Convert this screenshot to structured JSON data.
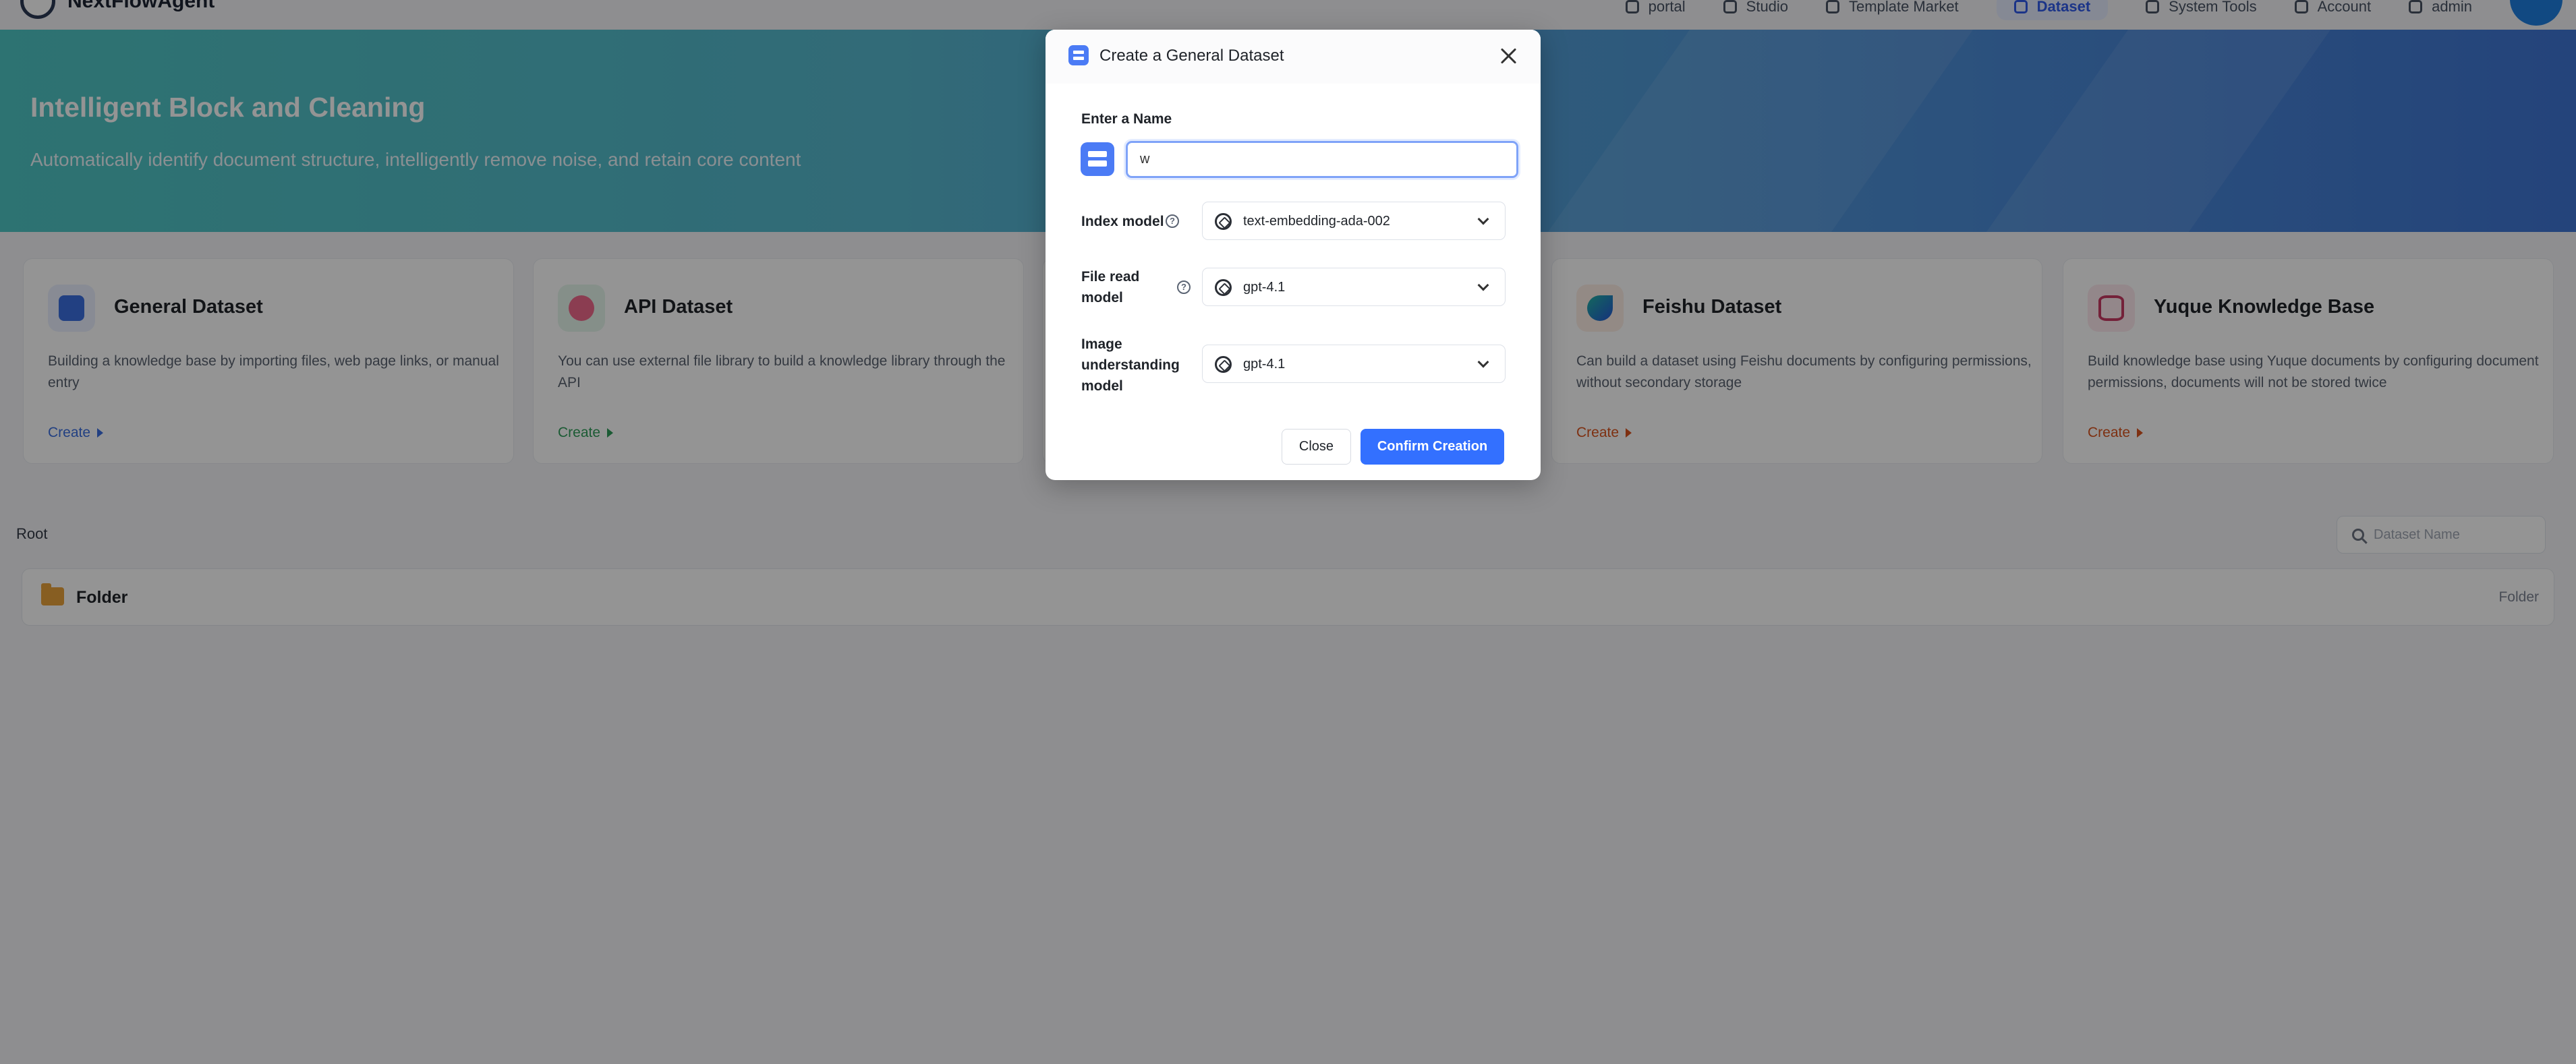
{
  "nav": {
    "brand": "NextFlowAgent",
    "items": [
      {
        "label": "portal",
        "icon": "portal-icon"
      },
      {
        "label": "Studio",
        "icon": "studio-icon"
      },
      {
        "label": "Template Market",
        "icon": "template-icon"
      },
      {
        "label": "Dataset",
        "icon": "dataset-icon",
        "active": true
      },
      {
        "label": "System Tools",
        "icon": "tools-icon"
      },
      {
        "label": "Account",
        "icon": "account-icon"
      },
      {
        "label": "admin",
        "icon": "user-icon"
      }
    ]
  },
  "banner": {
    "title": "Intelligent Block and Cleaning",
    "subtitle": "Automatically identify document structure, intelligently remove noise, and retain core content"
  },
  "cards": [
    {
      "title": "General Dataset",
      "desc": "Building a knowledge base by importing files, web page links, or manual entry",
      "create": "Create",
      "accent": "#3b6fe0",
      "icon": "general-dataset-icon"
    },
    {
      "title": "API Dataset",
      "desc": "You can use external file library to build a knowledge library through the API",
      "create": "Create",
      "accent": "#2f9e5a",
      "icon": "api-dataset-icon"
    },
    {
      "title": "Feishu Dataset",
      "desc": "Can build a dataset using Feishu documents by configuring permissions, without secondary storage",
      "create": "Create",
      "accent": "#d9531e",
      "icon": "feishu-icon"
    },
    {
      "title": "Yuque Knowledge Base",
      "desc": "Build knowledge base using Yuque documents by configuring document permissions, documents will not be stored twice",
      "create": "Create",
      "accent": "#d9531e",
      "icon": "yuque-icon"
    }
  ],
  "breadcrumb": {
    "root": "Root"
  },
  "search": {
    "placeholder": "Dataset Name"
  },
  "folder": {
    "name": "Folder",
    "type": "Folder"
  },
  "modal": {
    "title": "Create a General Dataset",
    "name_label": "Enter a Name",
    "name_value": "w",
    "index_model_label": "Index model",
    "index_model_value": "text-embedding-ada-002",
    "file_read_label": "File read model",
    "file_read_value": "gpt-4.1",
    "image_label": "Image understanding model",
    "image_value": "gpt-4.1",
    "close_label": "Close",
    "confirm_label": "Confirm Creation"
  }
}
